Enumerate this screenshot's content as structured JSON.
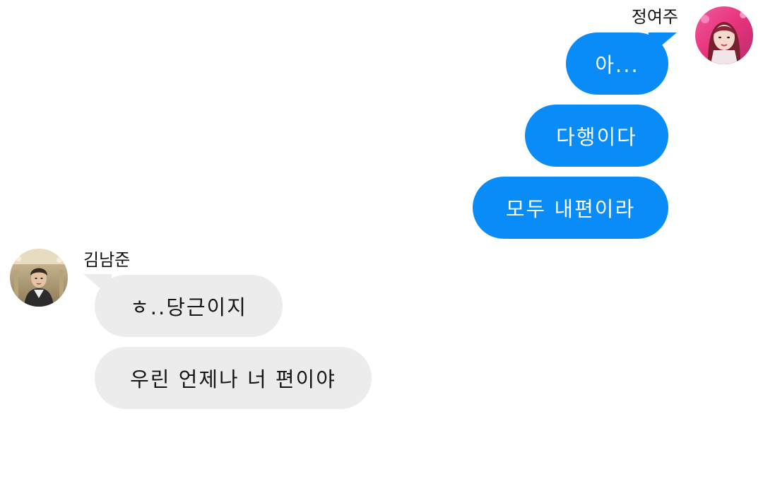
{
  "colors": {
    "outgoing_bubble": "#0a8cf8",
    "incoming_bubble": "#ececec",
    "background": "#ffffff"
  },
  "chat": {
    "right_participant": {
      "name": "정여주",
      "avatar_icon": "avatar-photo-icon"
    },
    "left_participant": {
      "name": "김남준",
      "avatar_icon": "avatar-photo-icon"
    },
    "messages": [
      {
        "side": "right",
        "text": "아..."
      },
      {
        "side": "right",
        "text": "다행이다"
      },
      {
        "side": "right",
        "text": "모두 내편이라"
      },
      {
        "side": "left",
        "text": "ㅎ..당근이지"
      },
      {
        "side": "left",
        "text": "우린 언제나 너 편이야"
      }
    ]
  }
}
